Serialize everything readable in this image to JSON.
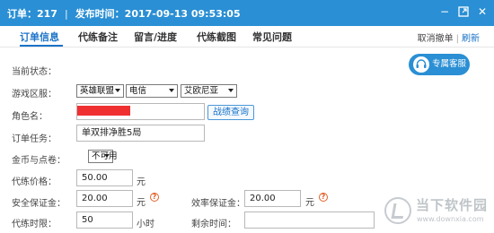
{
  "titlebar": {
    "order": "订单：217",
    "separator": "|",
    "publish_time": "发布时间：2017-09-13 09:53:05",
    "minimize": "−",
    "close": "✕"
  },
  "tabs": [
    {
      "label": "订单信息"
    },
    {
      "label": "代练备注"
    },
    {
      "label": "留言/进度"
    },
    {
      "label": "代练截图"
    },
    {
      "label": "常见问题"
    }
  ],
  "tab_actions": {
    "cancel": "取消撤单",
    "bar": "|",
    "refresh": "刷新"
  },
  "service_button": "专属客服",
  "form": {
    "status_label": "当前状态：",
    "region_label": "游戏区服：",
    "game": "英雄联盟",
    "server": "电信",
    "zone": "艾欧尼亚",
    "role_label": "角色名：",
    "query_button": "战绩查询",
    "task_label": "订单任务：",
    "task_value": "单双排净胜5局",
    "coin_label": "金币与点卷：",
    "coin_value": "不可用",
    "price_label": "代练价格：",
    "price_value": "50.00",
    "price_unit": "元",
    "safety_label": "安全保证金：",
    "safety_value": "20.00",
    "safety_unit": "元",
    "efficiency_label": "效率保证金：",
    "efficiency_value": "20.00",
    "efficiency_unit": "元",
    "time_label": "代练时限：",
    "time_value": "50",
    "time_unit": "小时",
    "remaining_label": "剩余时间：",
    "remaining_value": ""
  },
  "watermark": {
    "cn": "当下软件园",
    "en": "www.downxia.com"
  }
}
